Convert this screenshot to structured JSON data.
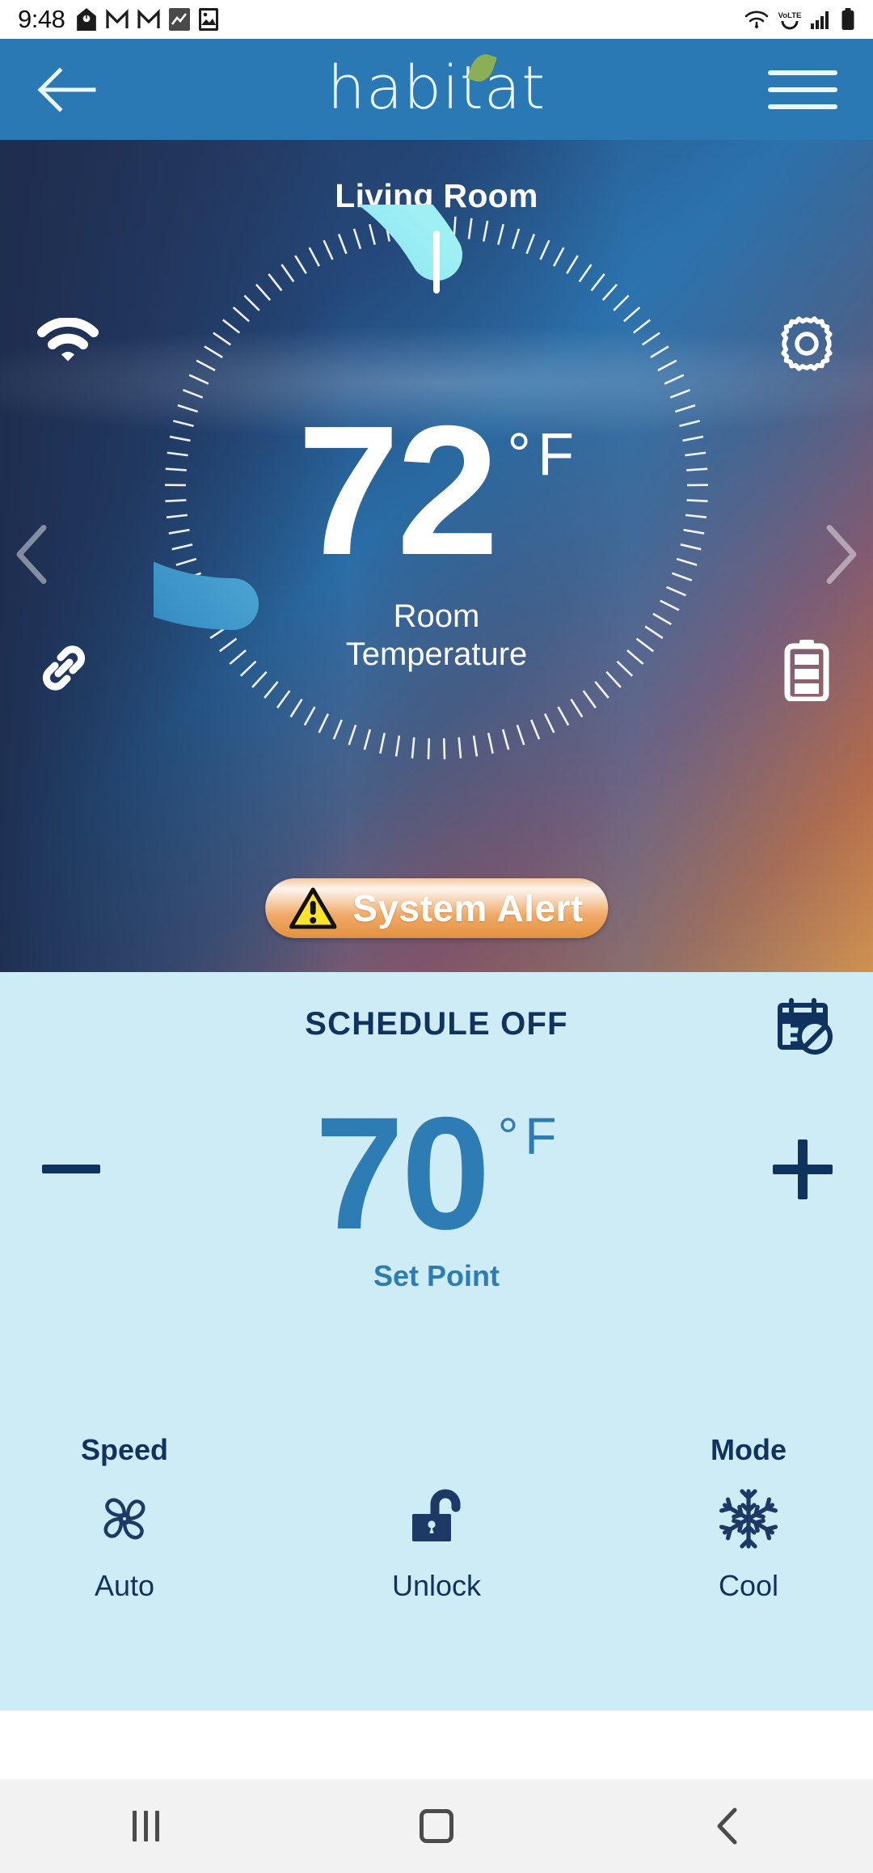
{
  "status_bar": {
    "time": "9:48",
    "left_icons": [
      "home-alarm-icon",
      "gmail-icon",
      "gmail-icon",
      "stocks-icon",
      "gallery-icon"
    ],
    "right_icons": [
      "wifi-icon",
      "volte-icon",
      "signal-icon",
      "battery-icon"
    ],
    "volte_label": "VoLTE"
  },
  "app_bar": {
    "back_icon": "back-arrow-icon",
    "logo_text": "habitat",
    "menu_icon": "hamburger-menu-icon"
  },
  "hero": {
    "room_name": "Living Room",
    "current_temperature": "72",
    "degree_symbol": "°",
    "unit": "F",
    "sub_line_1": "Room",
    "sub_line_2": "Temperature",
    "wifi_icon": "wifi-icon",
    "settings_icon": "gear-icon",
    "link_icon": "link-icon",
    "battery_icon": "battery-icon",
    "prev_icon": "chevron-left-icon",
    "next_icon": "chevron-right-icon",
    "alert": {
      "label": "System Alert",
      "icon": "warning-triangle-icon",
      "pill_color": "#ed9f56"
    }
  },
  "panel": {
    "schedule_status": "SCHEDULE OFF",
    "schedule_icon": "calendar-off-icon",
    "setpoint": {
      "value": "70",
      "degree_symbol": "°",
      "unit": "F",
      "label": "Set Point",
      "decrease_icon": "minus-icon",
      "increase_icon": "plus-icon"
    },
    "controls": [
      {
        "top_label": "Speed",
        "icon": "fan-icon",
        "bottom_label": "Auto"
      },
      {
        "top_label": "",
        "icon": "unlock-icon",
        "bottom_label": "Unlock"
      },
      {
        "top_label": "Mode",
        "icon": "snowflake-icon",
        "bottom_label": "Cool"
      }
    ]
  },
  "nav_bar": {
    "recents_icon": "recents-icon",
    "home_icon": "home-icon",
    "back_icon": "back-icon"
  },
  "colors": {
    "app_bar": "#2a79b5",
    "panel_bg": "#cdecf6",
    "accent_blue": "#2e7cb4",
    "deep_navy": "#10325f",
    "alert_orange": "#ed9f56",
    "arc_light": "#8fe6f0",
    "arc_dark": "#3e96c9"
  }
}
